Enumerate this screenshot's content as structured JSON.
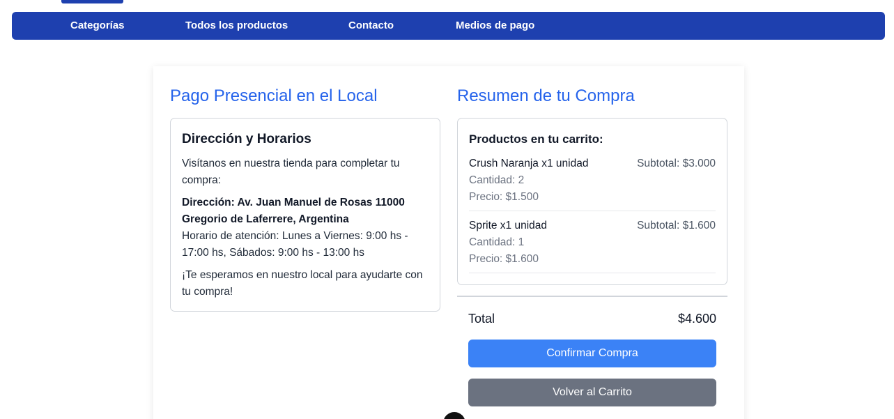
{
  "nav": {
    "items": [
      {
        "label": "Categorías"
      },
      {
        "label": "Todos los productos"
      },
      {
        "label": "Contacto"
      },
      {
        "label": "Medios de pago"
      }
    ]
  },
  "payment": {
    "title": "Pago Presencial en el Local",
    "heading": "Dirección y Horarios",
    "intro": "Visítanos en nuestra tienda para completar tu compra:",
    "address_line1": "Dirección: Av. Juan Manuel de Rosas 11000",
    "address_line2": "Gregorio de Laferrere, Argentina",
    "hours": "Horario de atención: Lunes a Viernes: 9:00 hs - 17:00 hs, Sábados: 9:00 hs - 13:00 hs",
    "closing": "¡Te esperamos en nuestro local para ayudarte con tu compra!"
  },
  "summary": {
    "title": "Resumen de tu Compra",
    "heading": "Productos en tu carrito:",
    "products": [
      {
        "name": "Crush Naranja x1 unidad",
        "subtotal": "Subtotal: $3.000",
        "quantity": "Cantidad: 2",
        "price": "Precio: $1.500"
      },
      {
        "name": "Sprite x1 unidad",
        "subtotal": "Subtotal: $1.600",
        "quantity": "Cantidad: 1",
        "price": "Precio: $1.600"
      }
    ],
    "total_label": "Total",
    "total_value": "$4.600",
    "confirm_label": "Confirmar Compra",
    "back_label": "Volver al Carrito"
  },
  "colors": {
    "nav_bg": "#1e40af",
    "accent": "#2563eb",
    "primary_button": "#3b82f6",
    "secondary_button": "#6b7280"
  }
}
